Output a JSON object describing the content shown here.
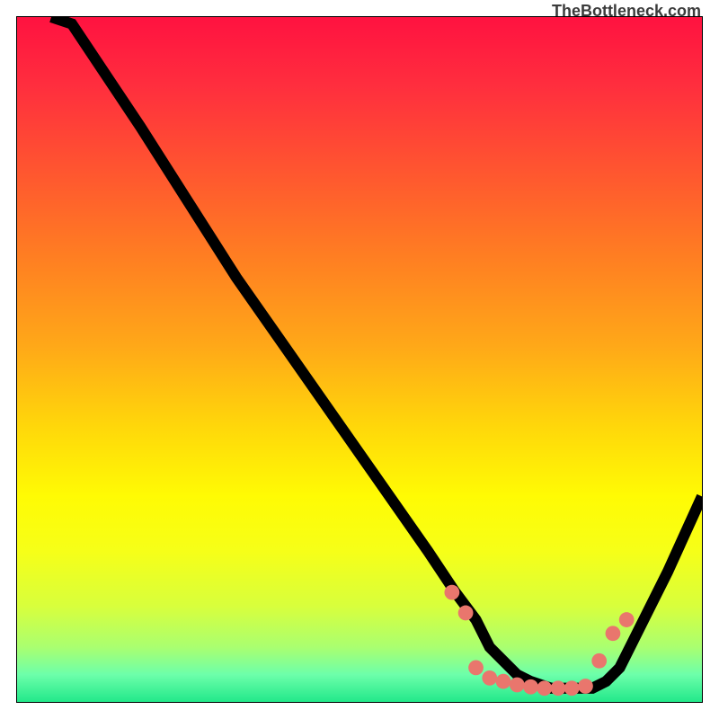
{
  "branding": "TheBottleneck.com",
  "colors": {
    "gradient_stops": [
      {
        "offset": 0.0,
        "color": "#ff1240"
      },
      {
        "offset": 0.1,
        "color": "#ff2e3e"
      },
      {
        "offset": 0.22,
        "color": "#ff5430"
      },
      {
        "offset": 0.35,
        "color": "#ff7e22"
      },
      {
        "offset": 0.48,
        "color": "#ffa818"
      },
      {
        "offset": 0.6,
        "color": "#ffd80a"
      },
      {
        "offset": 0.7,
        "color": "#fffb04"
      },
      {
        "offset": 0.78,
        "color": "#f6ff18"
      },
      {
        "offset": 0.86,
        "color": "#d8ff3c"
      },
      {
        "offset": 0.92,
        "color": "#aaff70"
      },
      {
        "offset": 0.96,
        "color": "#6dffaa"
      },
      {
        "offset": 1.0,
        "color": "#22e88a"
      }
    ],
    "dot_color": "#e9766d",
    "curve_color": "#000000",
    "border_color": "#000000"
  },
  "chart_data": {
    "type": "line",
    "title": "",
    "xlabel": "",
    "ylabel": "",
    "xlim": [
      0,
      100
    ],
    "ylim": [
      0,
      100
    ],
    "grid": false,
    "legend": false,
    "series": [
      {
        "name": "bottleneck-curve",
        "x": [
          5,
          8,
          12,
          18,
          25,
          32,
          39,
          46,
          53,
          60,
          64,
          67,
          69,
          71,
          73,
          75,
          78,
          80,
          82,
          84,
          86,
          88,
          90,
          92,
          95,
          100
        ],
        "y": [
          100,
          99,
          93,
          84,
          73,
          62,
          52,
          42,
          32,
          22,
          16,
          12,
          8,
          6,
          4,
          3,
          2,
          2,
          2,
          2,
          3,
          5,
          9,
          13,
          19,
          30
        ]
      }
    ],
    "highlight_points": {
      "name": "trough-points",
      "x": [
        63.5,
        65.5,
        67,
        69,
        71,
        73,
        75,
        77,
        79,
        81,
        83,
        85,
        87,
        89
      ],
      "y": [
        16,
        13,
        5,
        3.5,
        3,
        2.5,
        2.2,
        2,
        2,
        2,
        2.3,
        6,
        10,
        12
      ]
    }
  }
}
